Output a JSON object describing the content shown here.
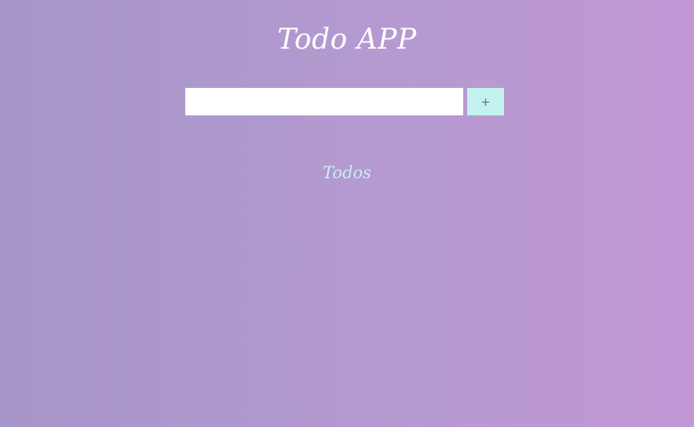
{
  "app": {
    "title": "Todo APP"
  },
  "form": {
    "input_value": "",
    "input_placeholder": "",
    "add_button_label": "+"
  },
  "todos": {
    "heading": "Todos",
    "items": []
  },
  "colors": {
    "background_start": "#a695c8",
    "background_end": "#c197d4",
    "add_button_bg": "#c4f2ef",
    "title_text": "#ffffff",
    "todos_heading_text": "#c9eef2"
  }
}
